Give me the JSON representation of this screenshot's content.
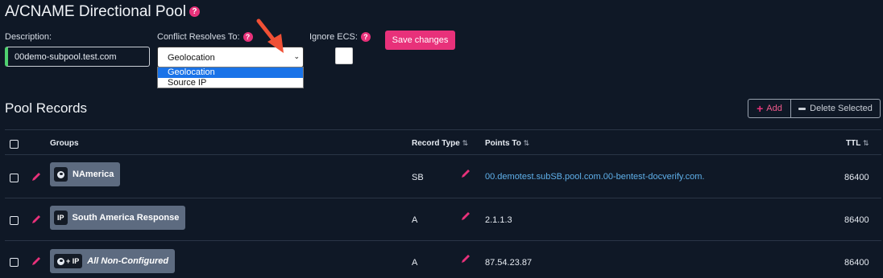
{
  "pool": {
    "title": "A/CNAME Directional Pool",
    "help": "?",
    "description_label": "Description:",
    "description_value": "00demo-subpool.test.com",
    "conflict_label": "Conflict Resolves To:",
    "conflict_selected": "Geolocation",
    "conflict_options": [
      "Geolocation",
      "Source IP"
    ],
    "ignore_ecs_label": "Ignore ECS:",
    "save_label": "Save changes"
  },
  "records": {
    "title": "Pool Records",
    "add_label": "Add",
    "delete_label": "Delete Selected",
    "headers": {
      "groups": "Groups",
      "record_type": "Record Type",
      "points_to": "Points To",
      "ttl": "TTL",
      "sort_glyph": "⇅"
    },
    "rows": [
      {
        "icon_text": "",
        "group": "NAmerica",
        "type": "SB",
        "points_to": "00.demotest.subSB.pool.com.00-bentest-docverify.com.",
        "ttl": "86400"
      },
      {
        "icon_text": "IP",
        "group": "South America Response",
        "type": "A",
        "points_to": "2.1.1.3",
        "ttl": "86400"
      },
      {
        "icon_text": "+ IP",
        "group": "All Non-Configured",
        "type": "A",
        "points_to": "87.54.23.87",
        "ttl": "86400"
      }
    ]
  },
  "colors": {
    "accent": "#e8317a",
    "background": "#0f1826",
    "link": "#5fb0ea",
    "badge": "#5d6b80",
    "arrow": "#f05035"
  }
}
